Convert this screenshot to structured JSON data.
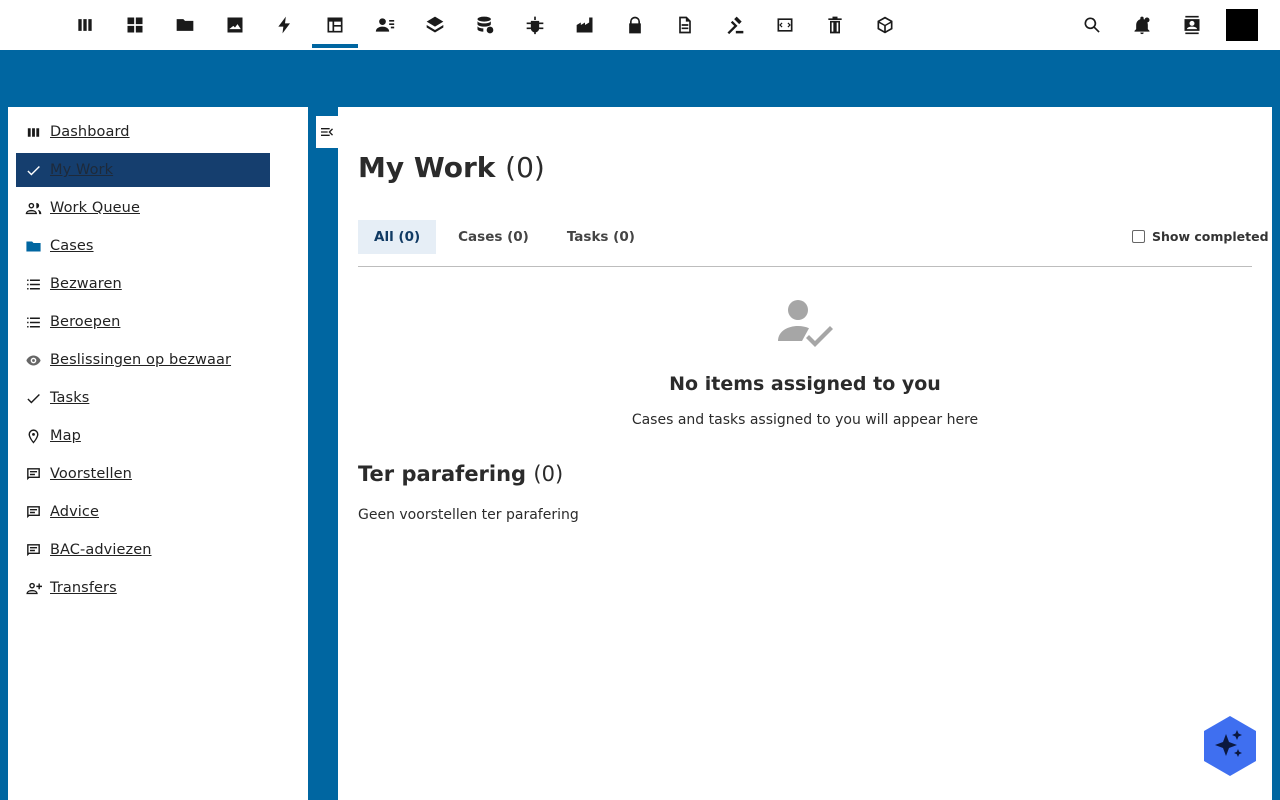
{
  "topnav": {
    "items": [
      {
        "icon": "view-column-icon"
      },
      {
        "icon": "dashboard-grid-icon"
      },
      {
        "icon": "folder-icon"
      },
      {
        "icon": "image-icon"
      },
      {
        "icon": "bolt-icon"
      },
      {
        "icon": "table-view-icon",
        "active": true
      },
      {
        "icon": "person-list-icon"
      },
      {
        "icon": "layers-icon"
      },
      {
        "icon": "database-settings-icon"
      },
      {
        "icon": "bug-icon"
      },
      {
        "icon": "factory-chart-icon"
      },
      {
        "icon": "lock-icon"
      },
      {
        "icon": "document-icon"
      },
      {
        "icon": "gavel-icon"
      },
      {
        "icon": "code-icon"
      },
      {
        "icon": "trash-icon"
      },
      {
        "icon": "cube-icon"
      }
    ],
    "right": [
      {
        "icon": "search-icon"
      },
      {
        "icon": "notifications-icon"
      },
      {
        "icon": "contacts-icon"
      }
    ]
  },
  "sidebar": {
    "items": [
      {
        "label": "Dashboard",
        "icon": "view-column-icon"
      },
      {
        "label": "My Work",
        "icon": "check-icon",
        "active": true
      },
      {
        "label": "Work Queue",
        "icon": "people-icon"
      },
      {
        "label": "Cases",
        "icon": "folder-icon"
      },
      {
        "label": "Bezwaren",
        "icon": "list-icon"
      },
      {
        "label": "Beroepen",
        "icon": "list-icon"
      },
      {
        "label": "Beslissingen op bezwaar",
        "icon": "eye-icon"
      },
      {
        "label": "Tasks",
        "icon": "check-icon"
      },
      {
        "label": "Map",
        "icon": "location-pin-icon"
      },
      {
        "label": "Voorstellen",
        "icon": "comment-icon"
      },
      {
        "label": "Advice",
        "icon": "comment-icon"
      },
      {
        "label": "BAC-adviezen",
        "icon": "comment-icon"
      },
      {
        "label": "Transfers",
        "icon": "person-add-icon"
      }
    ]
  },
  "main": {
    "title": "My Work",
    "title_count": "(0)",
    "tabs": [
      {
        "label": "All (0)",
        "active": true
      },
      {
        "label": "Cases (0)"
      },
      {
        "label": "Tasks (0)"
      }
    ],
    "show_completed_label": "Show completed",
    "empty_title": "No items assigned to you",
    "empty_subtitle": "Cases and tasks assigned to you will appear here",
    "section_title": "Ter parafering",
    "section_count": "(0)",
    "section_text": "Geen voorstellen ter parafering"
  },
  "colors": {
    "brand": "#0066a1",
    "active_nav": "#153e6e",
    "fab": "#3f6ff0"
  }
}
